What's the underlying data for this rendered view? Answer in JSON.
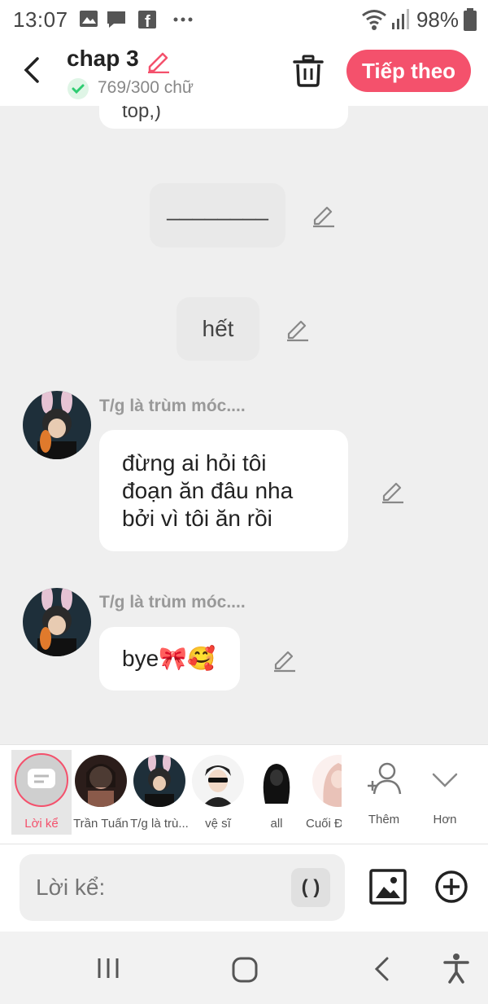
{
  "status": {
    "time": "13:07",
    "battery": "98%"
  },
  "header": {
    "title": "chap 3",
    "word_count": "769/300 chữ",
    "next_label": "Tiếp theo"
  },
  "chat": {
    "cut_text": "top,)",
    "narration_1": "________",
    "narration_2": "hết",
    "msg1": {
      "sender": "T/g là trùm móc....",
      "lines": [
        "đừng ai hỏi tôi",
        "đoạn ăn đâu nha",
        "bởi vì tôi ăn rồi"
      ]
    },
    "msg2": {
      "sender": "T/g là trùm móc....",
      "text": "bye🎀🥰"
    }
  },
  "characters": [
    {
      "label": "Lời kể",
      "icon": "narrator-icon",
      "active": true
    },
    {
      "label": "Trần Tuấn",
      "icon": "avatar"
    },
    {
      "label": "T/g là trù...",
      "icon": "avatar"
    },
    {
      "label": "vệ sĩ",
      "icon": "avatar"
    },
    {
      "label": "all",
      "icon": "avatar"
    },
    {
      "label": "Cuối Đ",
      "icon": "avatar"
    },
    {
      "label": "Thêm",
      "icon": "add-user-icon"
    },
    {
      "label": "Hơn",
      "icon": "chevron-down-icon"
    }
  ],
  "input": {
    "placeholder": "Lời kể:",
    "paren_label": "( )"
  },
  "colors": {
    "accent": "#f4516c",
    "check": "#2ecc71",
    "chat_bg": "#efefef"
  }
}
